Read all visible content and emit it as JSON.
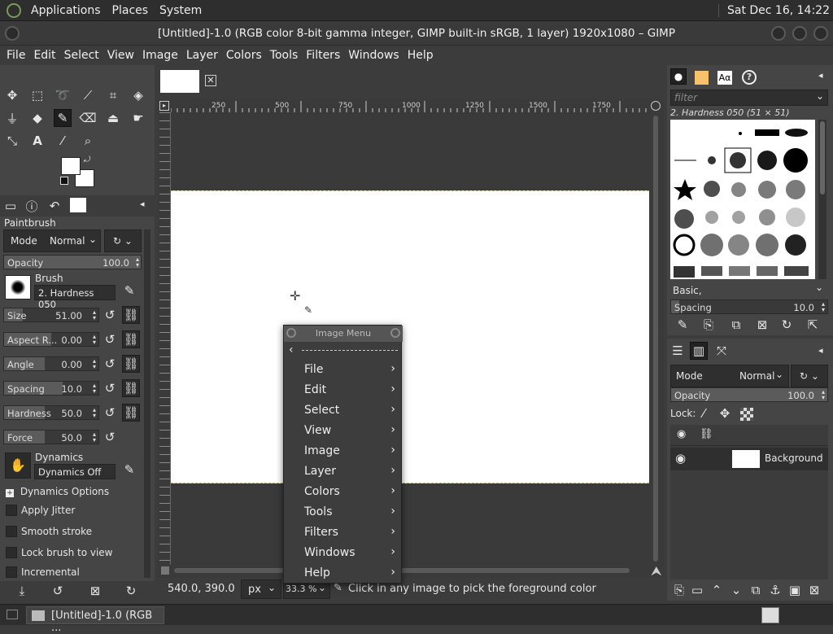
{
  "topbar": {
    "menus": [
      "Applications",
      "Places",
      "System"
    ],
    "clock": "Sat Dec 16, 14:22"
  },
  "window": {
    "title": "[Untitled]-1.0 (RGB color 8-bit gamma integer, GIMP built-in sRGB, 1 layer) 1920x1080 – GIMP"
  },
  "menubar": [
    "File",
    "Edit",
    "Select",
    "View",
    "Image",
    "Layer",
    "Colors",
    "Tools",
    "Filters",
    "Windows",
    "Help"
  ],
  "tool_options": {
    "title": "Paintbrush",
    "mode_label": "Mode",
    "mode_value": "Normal",
    "opacity": {
      "label": "Opacity",
      "value": "100.0"
    },
    "brush_label": "Brush",
    "brush_value": "2. Hardness 050",
    "size": {
      "label": "Size",
      "value": "51.00"
    },
    "aspect": {
      "label": "Aspect R...",
      "value": "0.00"
    },
    "angle": {
      "label": "Angle",
      "value": "0.00"
    },
    "spacing": {
      "label": "Spacing",
      "value": "10.0"
    },
    "hardness": {
      "label": "Hardness",
      "value": "50.0"
    },
    "force": {
      "label": "Force",
      "value": "50.0"
    },
    "dynamics_label": "Dynamics",
    "dynamics_value": "Dynamics Off",
    "dynamics_options": "Dynamics Options",
    "apply_jitter": "Apply Jitter",
    "smooth_stroke": "Smooth stroke",
    "lock_brush": "Lock brush to view",
    "incremental": "Incremental"
  },
  "ruler": {
    "ticks": [
      "250",
      "500",
      "750",
      "1000",
      "1250",
      "1500",
      "1750"
    ]
  },
  "statusbar": {
    "coords": "540.0, 390.0",
    "unit": "px",
    "zoom": "33.3 %",
    "message": "Click in any image to pick the foreground color"
  },
  "image_menu": {
    "title": "Image Menu",
    "items": [
      "File",
      "Edit",
      "Select",
      "View",
      "Image",
      "Layer",
      "Colors",
      "Tools",
      "Filters",
      "Windows",
      "Help"
    ]
  },
  "brushes": {
    "filter_placeholder": "filter",
    "selected": "2. Hardness 050 (51 × 51)",
    "tag": "Basic,",
    "spacing": {
      "label": "Spacing",
      "value": "10.0"
    }
  },
  "layers": {
    "mode_label": "Mode",
    "mode_value": "Normal",
    "opacity": {
      "label": "Opacity",
      "value": "100.0"
    },
    "lock_label": "Lock:",
    "layer_name": "Background"
  },
  "taskbar": {
    "item": "[Untitled]-1.0 (RGB ..."
  }
}
